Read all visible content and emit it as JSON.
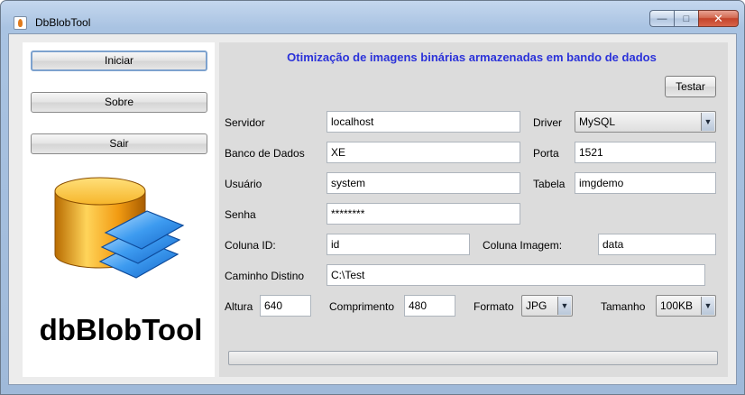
{
  "window": {
    "title": "DbBlobTool"
  },
  "nav": {
    "start": "Iniciar",
    "about": "Sobre",
    "exit": "Sair"
  },
  "brand": "dbBlobTool",
  "header": {
    "title": "Otimização de imagens binárias armazenadas em bando de dados",
    "test_button": "Testar"
  },
  "form": {
    "server_label": "Servidor",
    "server_value": "localhost",
    "driver_label": "Driver",
    "driver_value": "MySQL",
    "database_label": "Banco de Dados",
    "database_value": "XE",
    "port_label": "Porta",
    "port_value": "1521",
    "user_label": "Usuário",
    "user_value": "system",
    "table_label": "Tabela",
    "table_value": "imgdemo",
    "password_label": "Senha",
    "password_value": "********",
    "id_column_label": "Coluna ID:",
    "id_column_value": "id",
    "image_column_label": "Coluna Imagem:",
    "image_column_value": "data",
    "dest_path_label": "Caminho Distino",
    "dest_path_value": "C:\\Test",
    "height_label": "Altura",
    "height_value": "640",
    "width_label": "Comprimento",
    "width_value": "480",
    "format_label": "Formato",
    "format_value": "JPG",
    "size_label": "Tamanho",
    "size_value": "100KB"
  },
  "progress": {
    "value": 0
  },
  "colors": {
    "header_text": "#2b32d9",
    "logo_cylinder": "#f0a11a",
    "logo_layers": "#2f8fe6"
  }
}
